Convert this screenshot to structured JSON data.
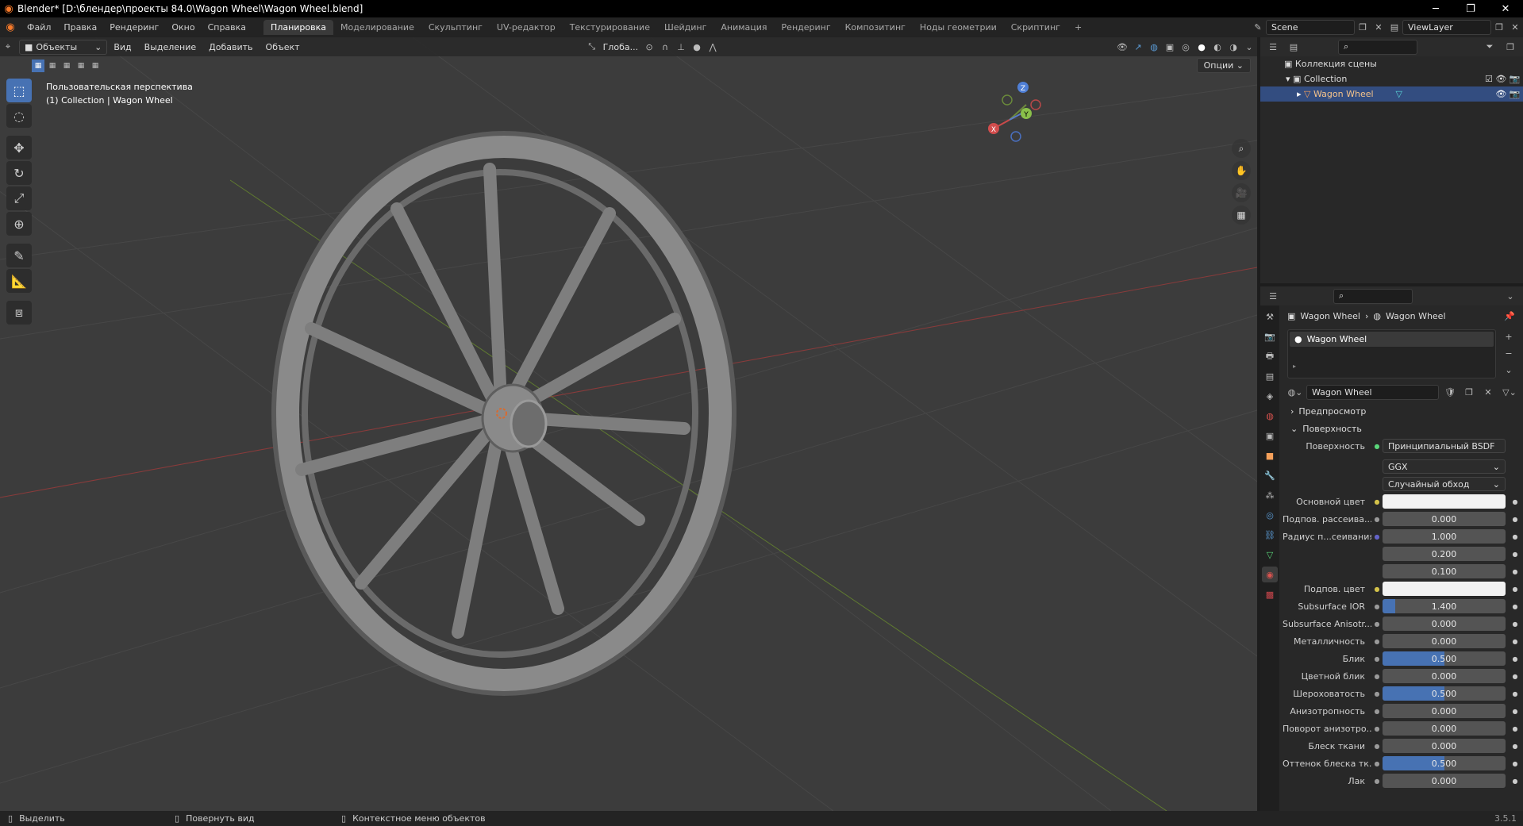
{
  "window": {
    "title": "Blender* [D:\\блендер\\проекты 84.0\\Wagon Wheel\\Wagon Wheel.blend]"
  },
  "menu": [
    "Файл",
    "Правка",
    "Рендеринг",
    "Окно",
    "Справка"
  ],
  "workspaces": [
    "Планировка",
    "Моделирование",
    "Скульптинг",
    "UV-редактор",
    "Текстурирование",
    "Шейдинг",
    "Анимация",
    "Рендеринг",
    "Композитинг",
    "Ноды геометрии",
    "Скриптинг"
  ],
  "active_workspace": "Планировка",
  "scene": {
    "name": "Scene",
    "view_layer": "ViewLayer"
  },
  "viewport": {
    "mode": "Объекты",
    "menus": [
      "Вид",
      "Выделение",
      "Добавить",
      "Объект"
    ],
    "orientation": "Глоба...",
    "options_label": "Опции",
    "info_line1": "Пользовательская перспектива",
    "info_line2": "(1) Collection | Wagon Wheel",
    "gizmo": {
      "x": "X",
      "y": "Y",
      "z": "Z"
    }
  },
  "outliner": {
    "rows": [
      "Коллекция сцены",
      "Collection",
      "Wagon Wheel"
    ]
  },
  "properties": {
    "breadcrumb_object": "Wagon Wheel",
    "breadcrumb_material": "Wagon Wheel",
    "slot": "Wagon Wheel",
    "material_name": "Wagon Wheel",
    "panel_preview": "Предпросмотр",
    "panel_surface": "Поверхность",
    "surface_label": "Поверхность",
    "surface_value": "Принципиальный BSDF",
    "distribution": "GGX",
    "subsurface_method": "Случайный обход",
    "rows": [
      {
        "label": "Основной цвет",
        "value": "",
        "fill": 0,
        "socket": "#d4c24a",
        "white": true
      },
      {
        "label": "Подпов. рассеива...",
        "value": "0.000",
        "fill": 0,
        "socket": "#9a9a9a"
      },
      {
        "label": "Радиус п...сеивания",
        "value": "1.000",
        "fill": 0,
        "socket": "#6363c7"
      },
      {
        "label": "",
        "value": "0.200",
        "fill": 0,
        "socket": ""
      },
      {
        "label": "",
        "value": "0.100",
        "fill": 0,
        "socket": ""
      },
      {
        "label": "Подпов. цвет",
        "value": "",
        "fill": 0,
        "socket": "#d4c24a",
        "white": true
      },
      {
        "label": "Subsurface IOR",
        "value": "1.400",
        "fill": 0.1,
        "socket": "#9a9a9a"
      },
      {
        "label": "Subsurface Anisotr...",
        "value": "0.000",
        "fill": 0,
        "socket": "#9a9a9a"
      },
      {
        "label": "Металличность",
        "value": "0.000",
        "fill": 0,
        "socket": "#9a9a9a"
      },
      {
        "label": "Блик",
        "value": "0.500",
        "fill": 0.5,
        "socket": "#9a9a9a"
      },
      {
        "label": "Цветной блик",
        "value": "0.000",
        "fill": 0,
        "socket": "#9a9a9a"
      },
      {
        "label": "Шероховатость",
        "value": "0.500",
        "fill": 0.5,
        "socket": "#9a9a9a"
      },
      {
        "label": "Анизотропность",
        "value": "0.000",
        "fill": 0,
        "socket": "#9a9a9a"
      },
      {
        "label": "Поворот анизотро...",
        "value": "0.000",
        "fill": 0,
        "socket": "#9a9a9a"
      },
      {
        "label": "Блеск ткани",
        "value": "0.000",
        "fill": 0,
        "socket": "#9a9a9a"
      },
      {
        "label": "Оттенок блеска тк...",
        "value": "0.500",
        "fill": 0.5,
        "socket": "#9a9a9a"
      },
      {
        "label": "Лак",
        "value": "0.000",
        "fill": 0,
        "socket": "#9a9a9a"
      }
    ]
  },
  "status": {
    "left": "Выделить",
    "middle": "Повернуть вид",
    "right": "Контекстное меню объектов",
    "version": "3.5.1"
  }
}
